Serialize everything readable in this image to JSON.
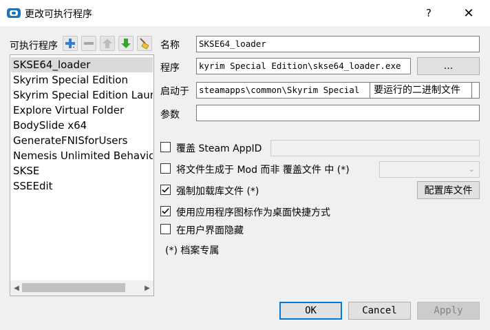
{
  "window": {
    "title": "更改可执行程序",
    "help_label": "?",
    "close_label": "✕"
  },
  "left_panel": {
    "label": "可执行程序",
    "toolbar": [
      {
        "name": "add-icon",
        "glyph": "+"
      },
      {
        "name": "remove-icon",
        "glyph": "−"
      },
      {
        "name": "move-up-icon",
        "glyph": "▲"
      },
      {
        "name": "move-down-icon",
        "glyph": "▼"
      },
      {
        "name": "clear-icon",
        "glyph": "✎"
      }
    ],
    "executables": [
      "SKSE64_loader",
      "Skyrim Special Edition",
      "Skyrim Special Edition Launcher",
      "Explore Virtual Folder",
      "BodySlide x64",
      "GenerateFNISforUsers",
      "Nemesis Unlimited Behavior Engine",
      "SKSE",
      "SSEEdit"
    ],
    "selected_index": 0
  },
  "form": {
    "name_label": "名称",
    "name_value": "SKSE64_loader",
    "program_label": "程序",
    "program_value": "kyrim Special Edition\\skse64_loader.exe",
    "browse_label": "...",
    "startin_label": "启动于",
    "startin_value": "steamapps\\common\\Skyrim Special",
    "startin_tooltip": "要运行的二进制文件",
    "args_label": "参数",
    "args_value": ""
  },
  "options": {
    "override_steam": {
      "label": "覆盖 Steam AppID",
      "checked": false,
      "value": ""
    },
    "create_files_in_mod": {
      "label": "将文件生成于 Mod 而非 覆盖文件 中 (*)",
      "checked": false,
      "selected": ""
    },
    "force_load_libs": {
      "label": "强制加载库文件 (*)",
      "checked": true,
      "button": "配置库文件"
    },
    "use_app_icon": {
      "label": "使用应用程序图标作为桌面快捷方式",
      "checked": true
    },
    "hide_in_ui": {
      "label": "在用户界面隐藏",
      "checked": false
    },
    "note": "(*) 档案专属"
  },
  "footer": {
    "ok": "OK",
    "cancel": "Cancel",
    "apply": "Apply"
  },
  "colors": {
    "accent": "#0078d7",
    "selection": "#dadada",
    "dialog_bg": "#f0f0f0"
  }
}
